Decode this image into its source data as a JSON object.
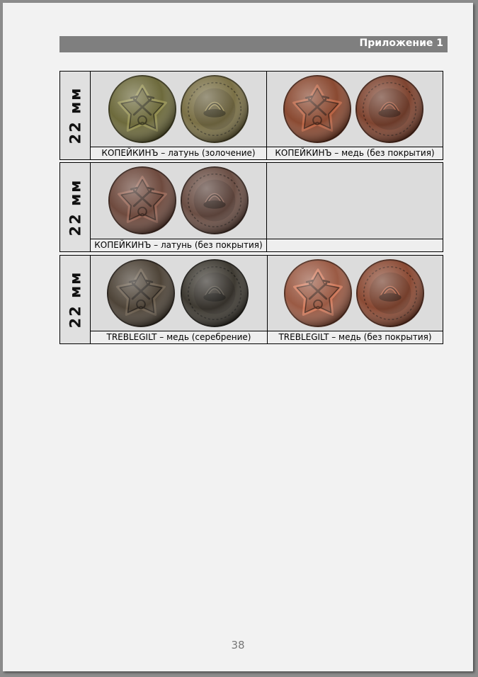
{
  "header": {
    "title": "Приложение 1"
  },
  "blocks": [
    {
      "size": "22 мм",
      "cells": [
        {
          "caption": "КОПЕЙКИНЪ – латунь (золочение)",
          "front_color": "#6d6a3c",
          "back_color": "#7a7046"
        },
        {
          "caption": "КОПЕЙКИНЪ – медь (без покрытия)",
          "front_color": "#8a4a32",
          "back_color": "#7e4430"
        }
      ]
    },
    {
      "size": "22 мм",
      "cells": [
        {
          "caption": "КОПЕЙКИНЪ – латунь (без покрытия)",
          "front_color": "#6e4a3e",
          "back_color": "#6a4e44"
        }
      ]
    },
    {
      "size": "22 мм",
      "cells": [
        {
          "caption": "TREBLEGILT – медь (серебрение)",
          "front_color": "#4e4438",
          "back_color": "#3e3a32"
        },
        {
          "caption": "TREBLEGILT – медь (без покрытия)",
          "front_color": "#9a5a44",
          "back_color": "#8a4a34"
        }
      ]
    }
  ],
  "icons": {
    "coin_front": "star-button-front-icon",
    "coin_back": "button-shank-back-icon"
  },
  "page_number": "38"
}
